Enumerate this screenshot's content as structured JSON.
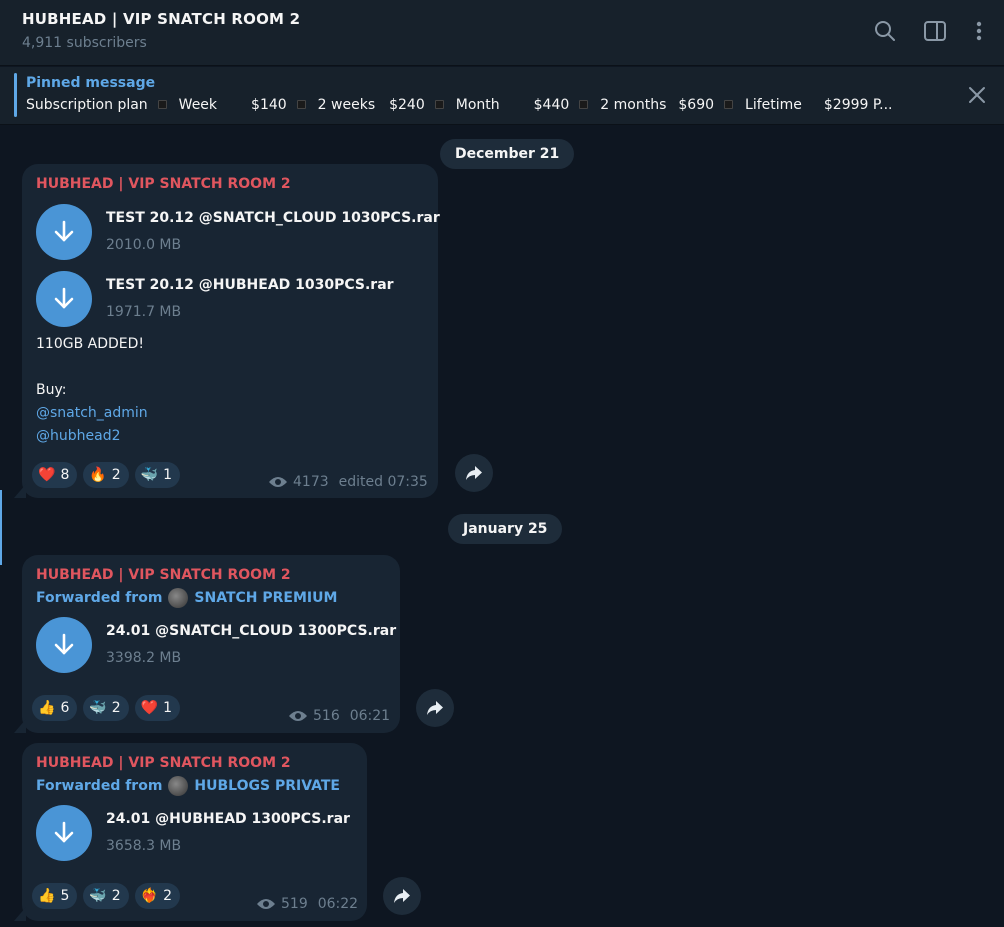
{
  "header": {
    "title": "HUBHEAD | VIP SNATCH ROOM 2",
    "subscribers": "4,911 subscribers",
    "icons": [
      "search-icon",
      "sidebar-toggle-icon",
      "more-vertical-icon"
    ]
  },
  "pinned": {
    "label": "Pinned message",
    "text_parts": [
      "Subscription plan",
      "Week",
      "$140",
      "2 weeks",
      "$240",
      "Month",
      "$440",
      "2 months",
      "$690",
      "Lifetime",
      "$2999",
      "P..."
    ]
  },
  "dates": [
    "December 21",
    "January 25"
  ],
  "messages": [
    {
      "sender": "HUBHEAD | VIP SNATCH ROOM 2",
      "files": [
        {
          "name": "TEST 20.12 @SNATCH_CLOUD 1030PCS.rar",
          "size": "2010.0 MB"
        },
        {
          "name": "TEST 20.12 @HUBHEAD 1030PCS.rar",
          "size": "1971.7 MB"
        }
      ],
      "text_line1": "110GB ADDED!",
      "text_line2": "Buy:",
      "mention1": "@snatch_admin",
      "mention2": "@hubhead2",
      "reactions": [
        {
          "emoji": "❤️",
          "count": "8"
        },
        {
          "emoji": "🔥",
          "count": "2"
        },
        {
          "emoji": "🐳",
          "count": "1"
        }
      ],
      "views": "4173",
      "time": "edited 07:35"
    },
    {
      "sender": "HUBHEAD | VIP SNATCH ROOM 2",
      "forwarded_label": "Forwarded from",
      "forwarded_from": "SNATCH PREMIUM",
      "files": [
        {
          "name": "24.01 @SNATCH_CLOUD 1300PCS.rar",
          "size": "3398.2 MB"
        }
      ],
      "reactions": [
        {
          "emoji": "👍",
          "count": "6"
        },
        {
          "emoji": "🐳",
          "count": "2"
        },
        {
          "emoji": "❤️",
          "count": "1"
        }
      ],
      "views": "516",
      "time": "06:21"
    },
    {
      "sender": "HUBHEAD | VIP SNATCH ROOM 2",
      "forwarded_label": "Forwarded from",
      "forwarded_from": "HUBLOGS PRIVATE",
      "files": [
        {
          "name": "24.01 @HUBHEAD 1300PCS.rar",
          "size": "3658.3 MB"
        }
      ],
      "reactions": [
        {
          "emoji": "👍",
          "count": "5"
        },
        {
          "emoji": "🐳",
          "count": "2"
        },
        {
          "emoji": "❤️‍🔥",
          "count": "2"
        }
      ],
      "views": "519",
      "time": "06:22"
    }
  ],
  "colors": {
    "background": "#0e1621",
    "panel": "#17212b",
    "bubble": "#182533",
    "accent": "#5fa8e7",
    "sender": "#e0565f",
    "download": "#4a95d6"
  }
}
